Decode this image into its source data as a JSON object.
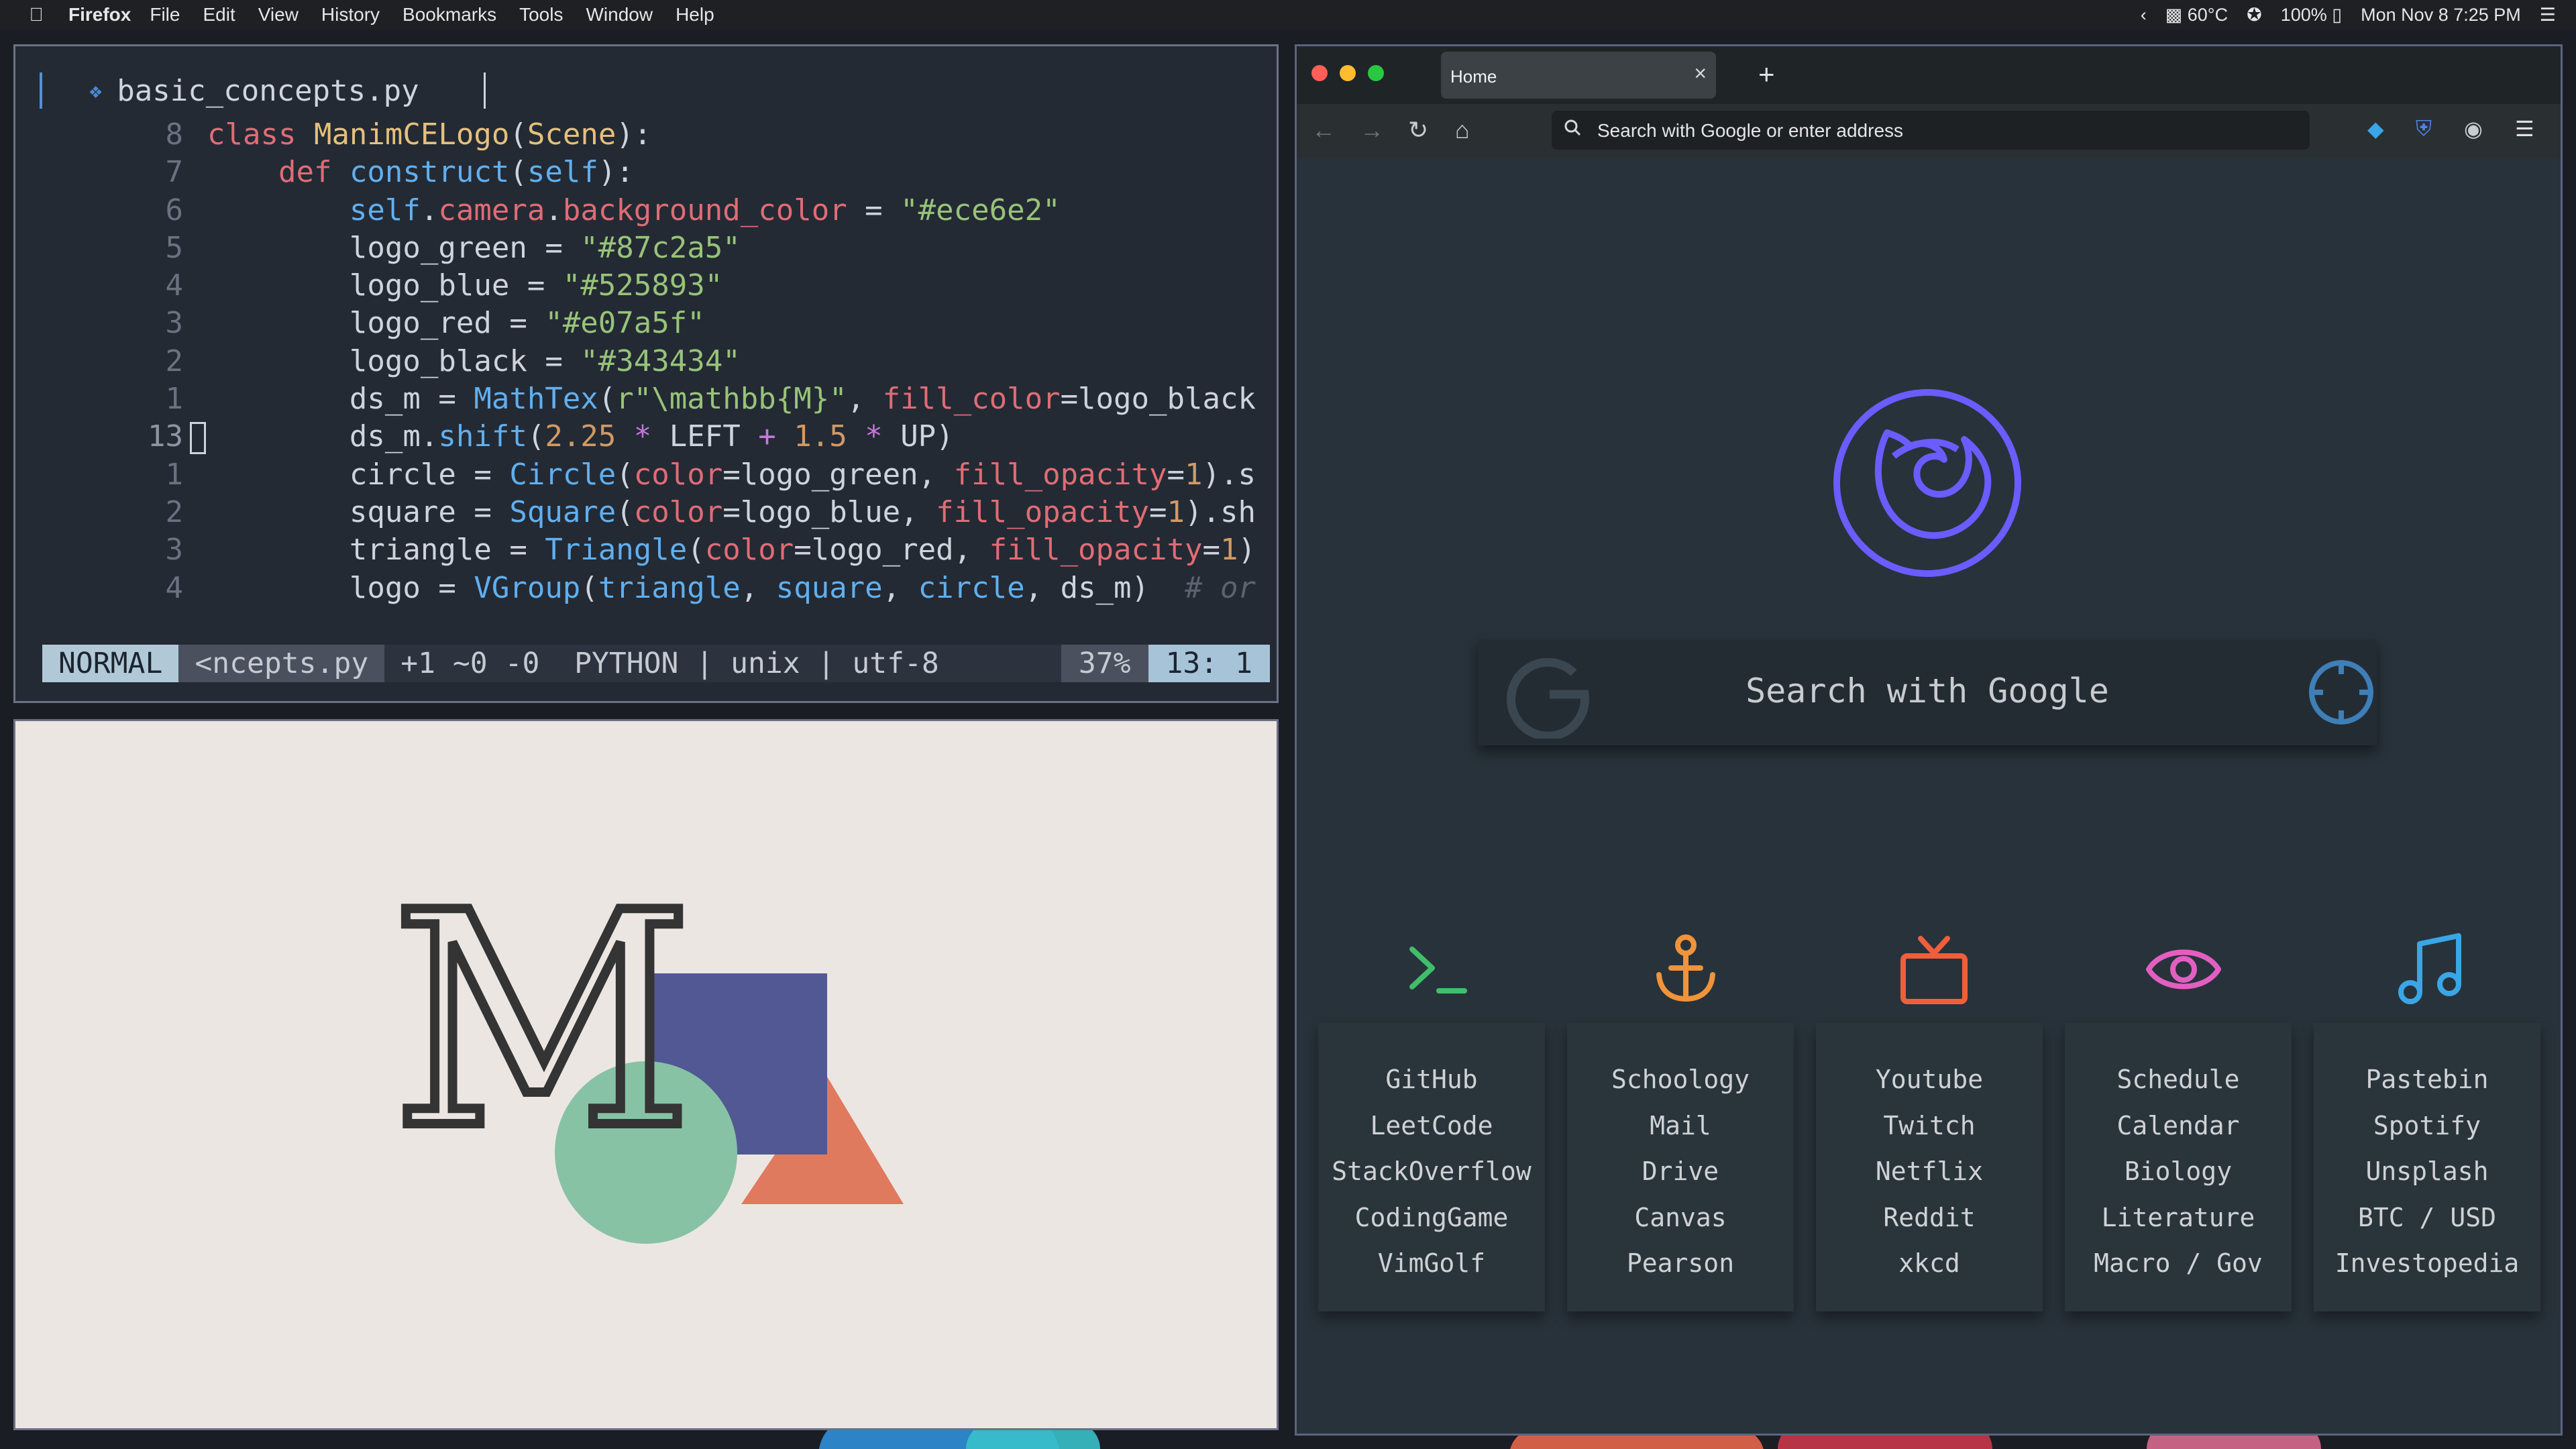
{
  "menubar": {
    "app_name": "Firefox",
    "menus": [
      "File",
      "Edit",
      "View",
      "History",
      "Bookmarks",
      "Tools",
      "Window",
      "Help"
    ],
    "status": {
      "temperature": "60°C",
      "battery": "100%",
      "datetime": "Mon Nov 8  7:25 PM"
    }
  },
  "editor": {
    "filename": "basic_concepts.py",
    "lines": [
      {
        "num": "8",
        "segments": [
          [
            "kw",
            "class "
          ],
          [
            "cls",
            "ManimCELogo"
          ],
          [
            "plain",
            "("
          ],
          [
            "cls",
            "Scene"
          ],
          [
            "plain",
            "):"
          ]
        ]
      },
      {
        "num": "7",
        "segments": [
          [
            "plain",
            "    "
          ],
          [
            "kw",
            "def "
          ],
          [
            "fn",
            "construct"
          ],
          [
            "plain",
            "("
          ],
          [
            "self",
            "self"
          ],
          [
            "plain",
            "):"
          ]
        ]
      },
      {
        "num": "6",
        "segments": [
          [
            "plain",
            "        "
          ],
          [
            "self",
            "self"
          ],
          [
            "plain",
            "."
          ],
          [
            "attr",
            "camera"
          ],
          [
            "plain",
            "."
          ],
          [
            "attr",
            "background_color"
          ],
          [
            "plain",
            " = "
          ],
          [
            "str",
            "\"#ece6e2\""
          ]
        ]
      },
      {
        "num": "5",
        "segments": [
          [
            "plain",
            "        logo_green = "
          ],
          [
            "str",
            "\"#87c2a5\""
          ]
        ]
      },
      {
        "num": "4",
        "segments": [
          [
            "plain",
            "        logo_blue = "
          ],
          [
            "str",
            "\"#525893\""
          ]
        ]
      },
      {
        "num": "3",
        "segments": [
          [
            "plain",
            "        logo_red = "
          ],
          [
            "str",
            "\"#e07a5f\""
          ]
        ]
      },
      {
        "num": "2",
        "segments": [
          [
            "plain",
            "        logo_black = "
          ],
          [
            "str",
            "\"#343434\""
          ]
        ]
      },
      {
        "num": "1",
        "segments": [
          [
            "plain",
            "        ds_m = "
          ],
          [
            "fn",
            "MathTex"
          ],
          [
            "plain",
            "("
          ],
          [
            "str",
            "r\"\\mathbb{M}\""
          ],
          [
            "plain",
            ", "
          ],
          [
            "attr",
            "fill_color"
          ],
          [
            "plain",
            "=logo_black"
          ]
        ]
      },
      {
        "num": "13",
        "current": true,
        "segments": [
          [
            "plain",
            "        ds_m."
          ],
          [
            "fn",
            "shift"
          ],
          [
            "plain",
            "("
          ],
          [
            "num",
            "2.25"
          ],
          [
            "op",
            " * "
          ],
          [
            "plain",
            "LEFT "
          ],
          [
            "op",
            "+"
          ],
          [
            "num",
            " 1.5"
          ],
          [
            "op",
            " * "
          ],
          [
            "plain",
            "UP)"
          ]
        ]
      },
      {
        "num": "1",
        "segments": [
          [
            "plain",
            "        circle = "
          ],
          [
            "fn",
            "Circle"
          ],
          [
            "plain",
            "("
          ],
          [
            "attr",
            "color"
          ],
          [
            "plain",
            "=logo_green, "
          ],
          [
            "attr",
            "fill_opacity"
          ],
          [
            "plain",
            "="
          ],
          [
            "num",
            "1"
          ],
          [
            "plain",
            ").s"
          ]
        ]
      },
      {
        "num": "2",
        "segments": [
          [
            "plain",
            "        square = "
          ],
          [
            "fn",
            "Square"
          ],
          [
            "plain",
            "("
          ],
          [
            "attr",
            "color"
          ],
          [
            "plain",
            "=logo_blue, "
          ],
          [
            "attr",
            "fill_opacity"
          ],
          [
            "plain",
            "="
          ],
          [
            "num",
            "1"
          ],
          [
            "plain",
            ").sh"
          ]
        ]
      },
      {
        "num": "3",
        "segments": [
          [
            "plain",
            "        triangle = "
          ],
          [
            "fn",
            "Triangle"
          ],
          [
            "plain",
            "("
          ],
          [
            "attr",
            "color"
          ],
          [
            "plain",
            "=logo_red, "
          ],
          [
            "attr",
            "fill_opacity"
          ],
          [
            "plain",
            "="
          ],
          [
            "num",
            "1"
          ],
          [
            "plain",
            ")"
          ]
        ]
      },
      {
        "num": "4",
        "segments": [
          [
            "plain",
            "        logo = "
          ],
          [
            "fn",
            "VGroup"
          ],
          [
            "plain",
            "("
          ],
          [
            "fn",
            "triangle"
          ],
          [
            "plain",
            ", "
          ],
          [
            "fn",
            "square"
          ],
          [
            "plain",
            ", "
          ],
          [
            "fn",
            "circle"
          ],
          [
            "plain",
            ", ds_m)  "
          ],
          [
            "cm",
            "# or"
          ]
        ]
      }
    ],
    "statusline": {
      "mode": "NORMAL",
      "file": "<ncepts.py",
      "info": "+1 ~0 -0  PYTHON | unix | utf-8",
      "percent": "37%",
      "position": "13: 1"
    }
  },
  "preview": {
    "glyph": "M",
    "colors": {
      "background": "#ece6e2",
      "green": "#87c2a5",
      "blue": "#525893",
      "red": "#e07a5f",
      "black": "#343434"
    }
  },
  "browser": {
    "tab_title": "Home",
    "address_placeholder": "Search with Google or enter address",
    "search_label": "Search with Google",
    "columns": [
      {
        "icon": "terminal-icon",
        "color": "#3fbf6a",
        "links": [
          "GitHub",
          "LeetCode",
          "StackOverflow",
          "CodingGame",
          "VimGolf"
        ]
      },
      {
        "icon": "anchor-icon",
        "color": "#f0933a",
        "links": [
          "Schoology",
          "Mail",
          "Drive",
          "Canvas",
          "Pearson"
        ]
      },
      {
        "icon": "tv-icon",
        "color": "#ef5f3c",
        "links": [
          "Youtube",
          "Twitch",
          "Netflix",
          "Reddit",
          "xkcd"
        ]
      },
      {
        "icon": "eye-icon",
        "color": "#e25fc1",
        "links": [
          "Schedule",
          "Calendar",
          "Biology",
          "Literature",
          "Macro / Gov"
        ]
      },
      {
        "icon": "music-icon",
        "color": "#3aa6e8",
        "links": [
          "Pastebin",
          "Spotify",
          "Unsplash",
          "BTC / USD",
          "Investopedia"
        ]
      }
    ]
  }
}
